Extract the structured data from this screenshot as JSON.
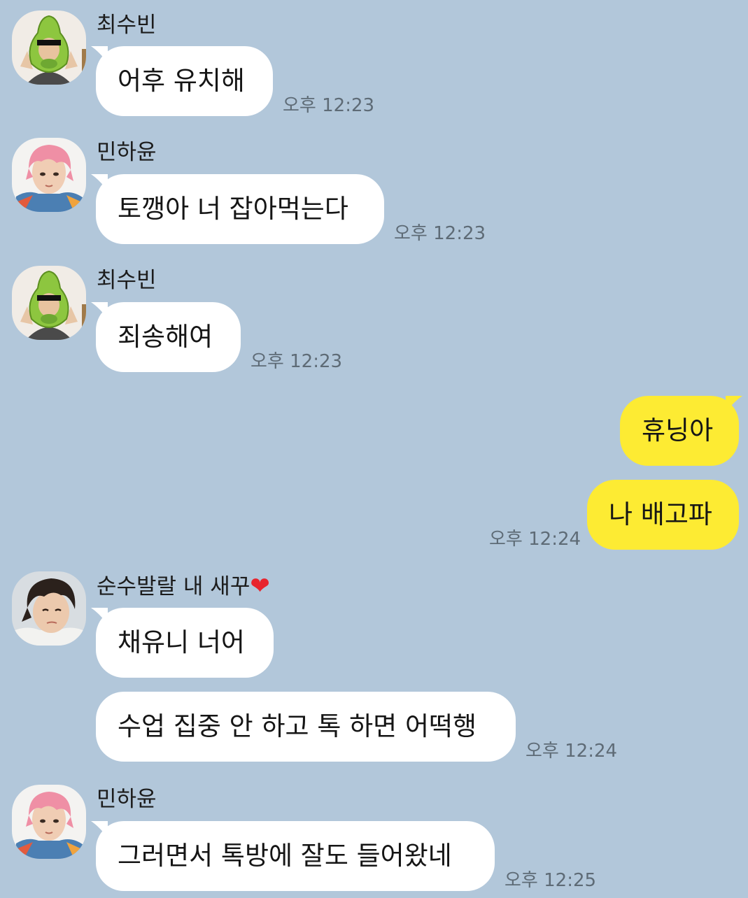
{
  "colors": {
    "background": "#b2c7da",
    "incoming_bubble": "#ffffff",
    "outgoing_bubble": "#fdeb33",
    "timestamp": "#5e6b76"
  },
  "messages": [
    {
      "sender": "최수빈",
      "avatar": "avocado-hat-avatar",
      "text": "어후 유치해",
      "time": "오후 12:23"
    },
    {
      "sender": "민하윤",
      "avatar": "pink-hair-avatar",
      "text": "토깽아 너 잡아먹는다",
      "time": "오후 12:23"
    },
    {
      "sender": "최수빈",
      "avatar": "avocado-hat-avatar",
      "text": "죄송해여",
      "time": "오후 12:23"
    },
    {
      "outgoing": true,
      "text": "휴닝아"
    },
    {
      "outgoing": true,
      "text": "나 배고파",
      "time": "오후 12:24"
    },
    {
      "sender": "순수발랄 내 새꾸",
      "sender_emoji": "❤",
      "avatar": "dark-hair-avatar",
      "text": "채유니 너어"
    },
    {
      "text": "수업 집중 안 하고 톡 하면 어떡행",
      "time": "오후 12:24"
    },
    {
      "sender": "민하윤",
      "avatar": "pink-hair-avatar",
      "text": "그러면서 톡방에 잘도 들어왔네",
      "time": "오후 12:25"
    }
  ]
}
